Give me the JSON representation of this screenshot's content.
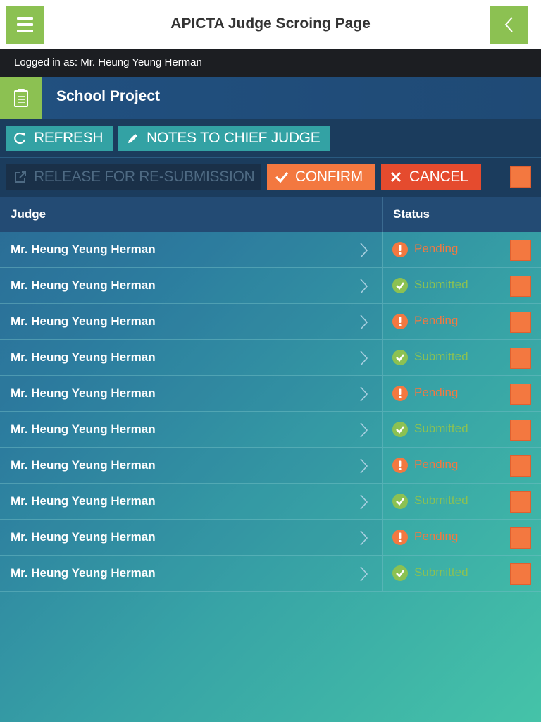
{
  "header": {
    "title": "APICTA Judge Scroing Page",
    "menu_icon": "hamburger-menu-icon",
    "back_icon": "chevron-left-icon"
  },
  "session": {
    "logged_in_text": "Logged in as: Mr. Heung Yeung Herman"
  },
  "section": {
    "title": "School Project",
    "icon": "clipboard-icon"
  },
  "toolbar": {
    "refresh_label": "REFRESH",
    "notes_label": "NOTES TO CHIEF JUDGE",
    "release_label": "RELEASE FOR RE-SUBMISSION",
    "confirm_label": "CONFIRM",
    "cancel_label": "CANCEL"
  },
  "table": {
    "columns": [
      "Judge",
      "Status"
    ],
    "rows": [
      {
        "judge": "Mr. Heung Yeung Herman",
        "status": "Pending"
      },
      {
        "judge": "Mr. Heung Yeung Herman",
        "status": "Submitted"
      },
      {
        "judge": "Mr. Heung Yeung Herman",
        "status": "Pending"
      },
      {
        "judge": "Mr. Heung Yeung Herman",
        "status": "Submitted"
      },
      {
        "judge": "Mr. Heung Yeung Herman",
        "status": "Pending"
      },
      {
        "judge": "Mr. Heung Yeung Herman",
        "status": "Submitted"
      },
      {
        "judge": "Mr. Heung Yeung Herman",
        "status": "Pending"
      },
      {
        "judge": "Mr. Heung Yeung Herman",
        "status": "Submitted"
      },
      {
        "judge": "Mr. Heung Yeung Herman",
        "status": "Pending"
      },
      {
        "judge": "Mr. Heung Yeung Herman",
        "status": "Submitted"
      }
    ]
  },
  "colors": {
    "green_accent": "#8cc152",
    "orange_accent": "#f37840",
    "red_accent": "#e54b2e",
    "teal_button": "#33a2a4",
    "dark_bar": "#1c1e22"
  }
}
